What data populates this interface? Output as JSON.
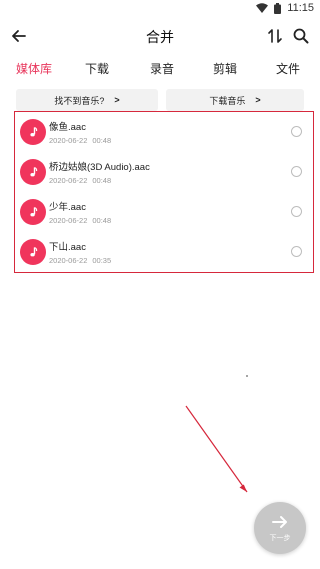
{
  "status_bar": {
    "time": "11:15"
  },
  "toolbar": {
    "title": "合并"
  },
  "tabs": [
    {
      "label": "媒体库",
      "active": true
    },
    {
      "label": "下载",
      "active": false
    },
    {
      "label": "录音",
      "active": false
    },
    {
      "label": "剪辑",
      "active": false
    },
    {
      "label": "文件",
      "active": false
    }
  ],
  "actions": {
    "find_music": {
      "label": "找不到音乐?",
      "arrow": ">"
    },
    "download_music": {
      "label": "下载音乐",
      "arrow": ">"
    }
  },
  "files": [
    {
      "name": "像鱼.aac",
      "date": "2020-06-22",
      "time": "00:48",
      "selected": false
    },
    {
      "name": "桥边姑娘(3D Audio).aac",
      "date": "2020-06-22",
      "time": "00:48",
      "selected": false
    },
    {
      "name": "少年.aac",
      "date": "2020-06-22",
      "time": "00:48",
      "selected": false
    },
    {
      "name": "下山.aac",
      "date": "2020-06-22",
      "time": "00:35",
      "selected": false
    }
  ],
  "next_button": {
    "label": "下一步"
  },
  "colors": {
    "accent": "#e8345a",
    "highlight_box": "#d6283c",
    "fab": "#c7c7c7"
  },
  "icons": [
    "wifi-icon",
    "battery-icon",
    "back-arrow-icon",
    "sort-icon",
    "search-icon",
    "music-note-icon",
    "arrow-right-icon"
  ]
}
